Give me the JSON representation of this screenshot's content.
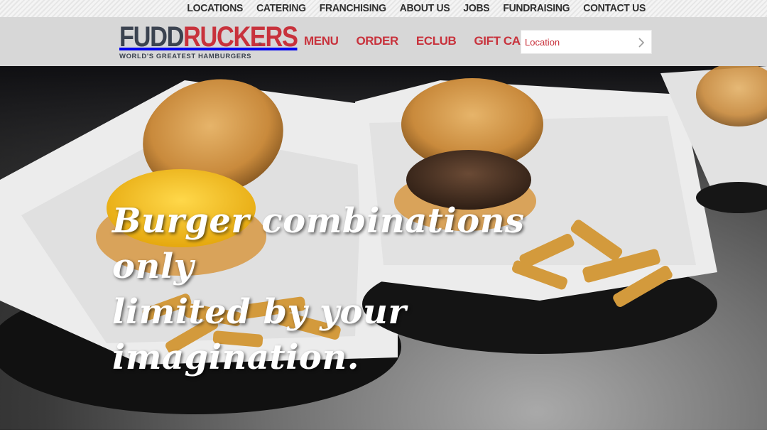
{
  "top_nav": {
    "items": [
      "LOCATIONS",
      "CATERING",
      "FRANCHISING",
      "ABOUT US",
      "JOBS",
      "FUNDRAISING",
      "CONTACT US"
    ]
  },
  "logo": {
    "word_dark": "FUDD",
    "word_red": "RUCKERS",
    "tagline": "WORLD'S GREATEST HAMBURGERS",
    "reg": "®"
  },
  "main_nav": {
    "items": [
      "MENU",
      "ORDER",
      "ECLUB",
      "GIFT CARDS"
    ]
  },
  "location_search": {
    "placeholder": "Location",
    "value": ""
  },
  "hero": {
    "headline_line1": "Burger combinations only",
    "headline_line2": "limited by your imagination."
  },
  "colors": {
    "brand_red": "#c8323c",
    "brand_dark": "#3b4350",
    "header_bg": "#d7d7d7"
  }
}
